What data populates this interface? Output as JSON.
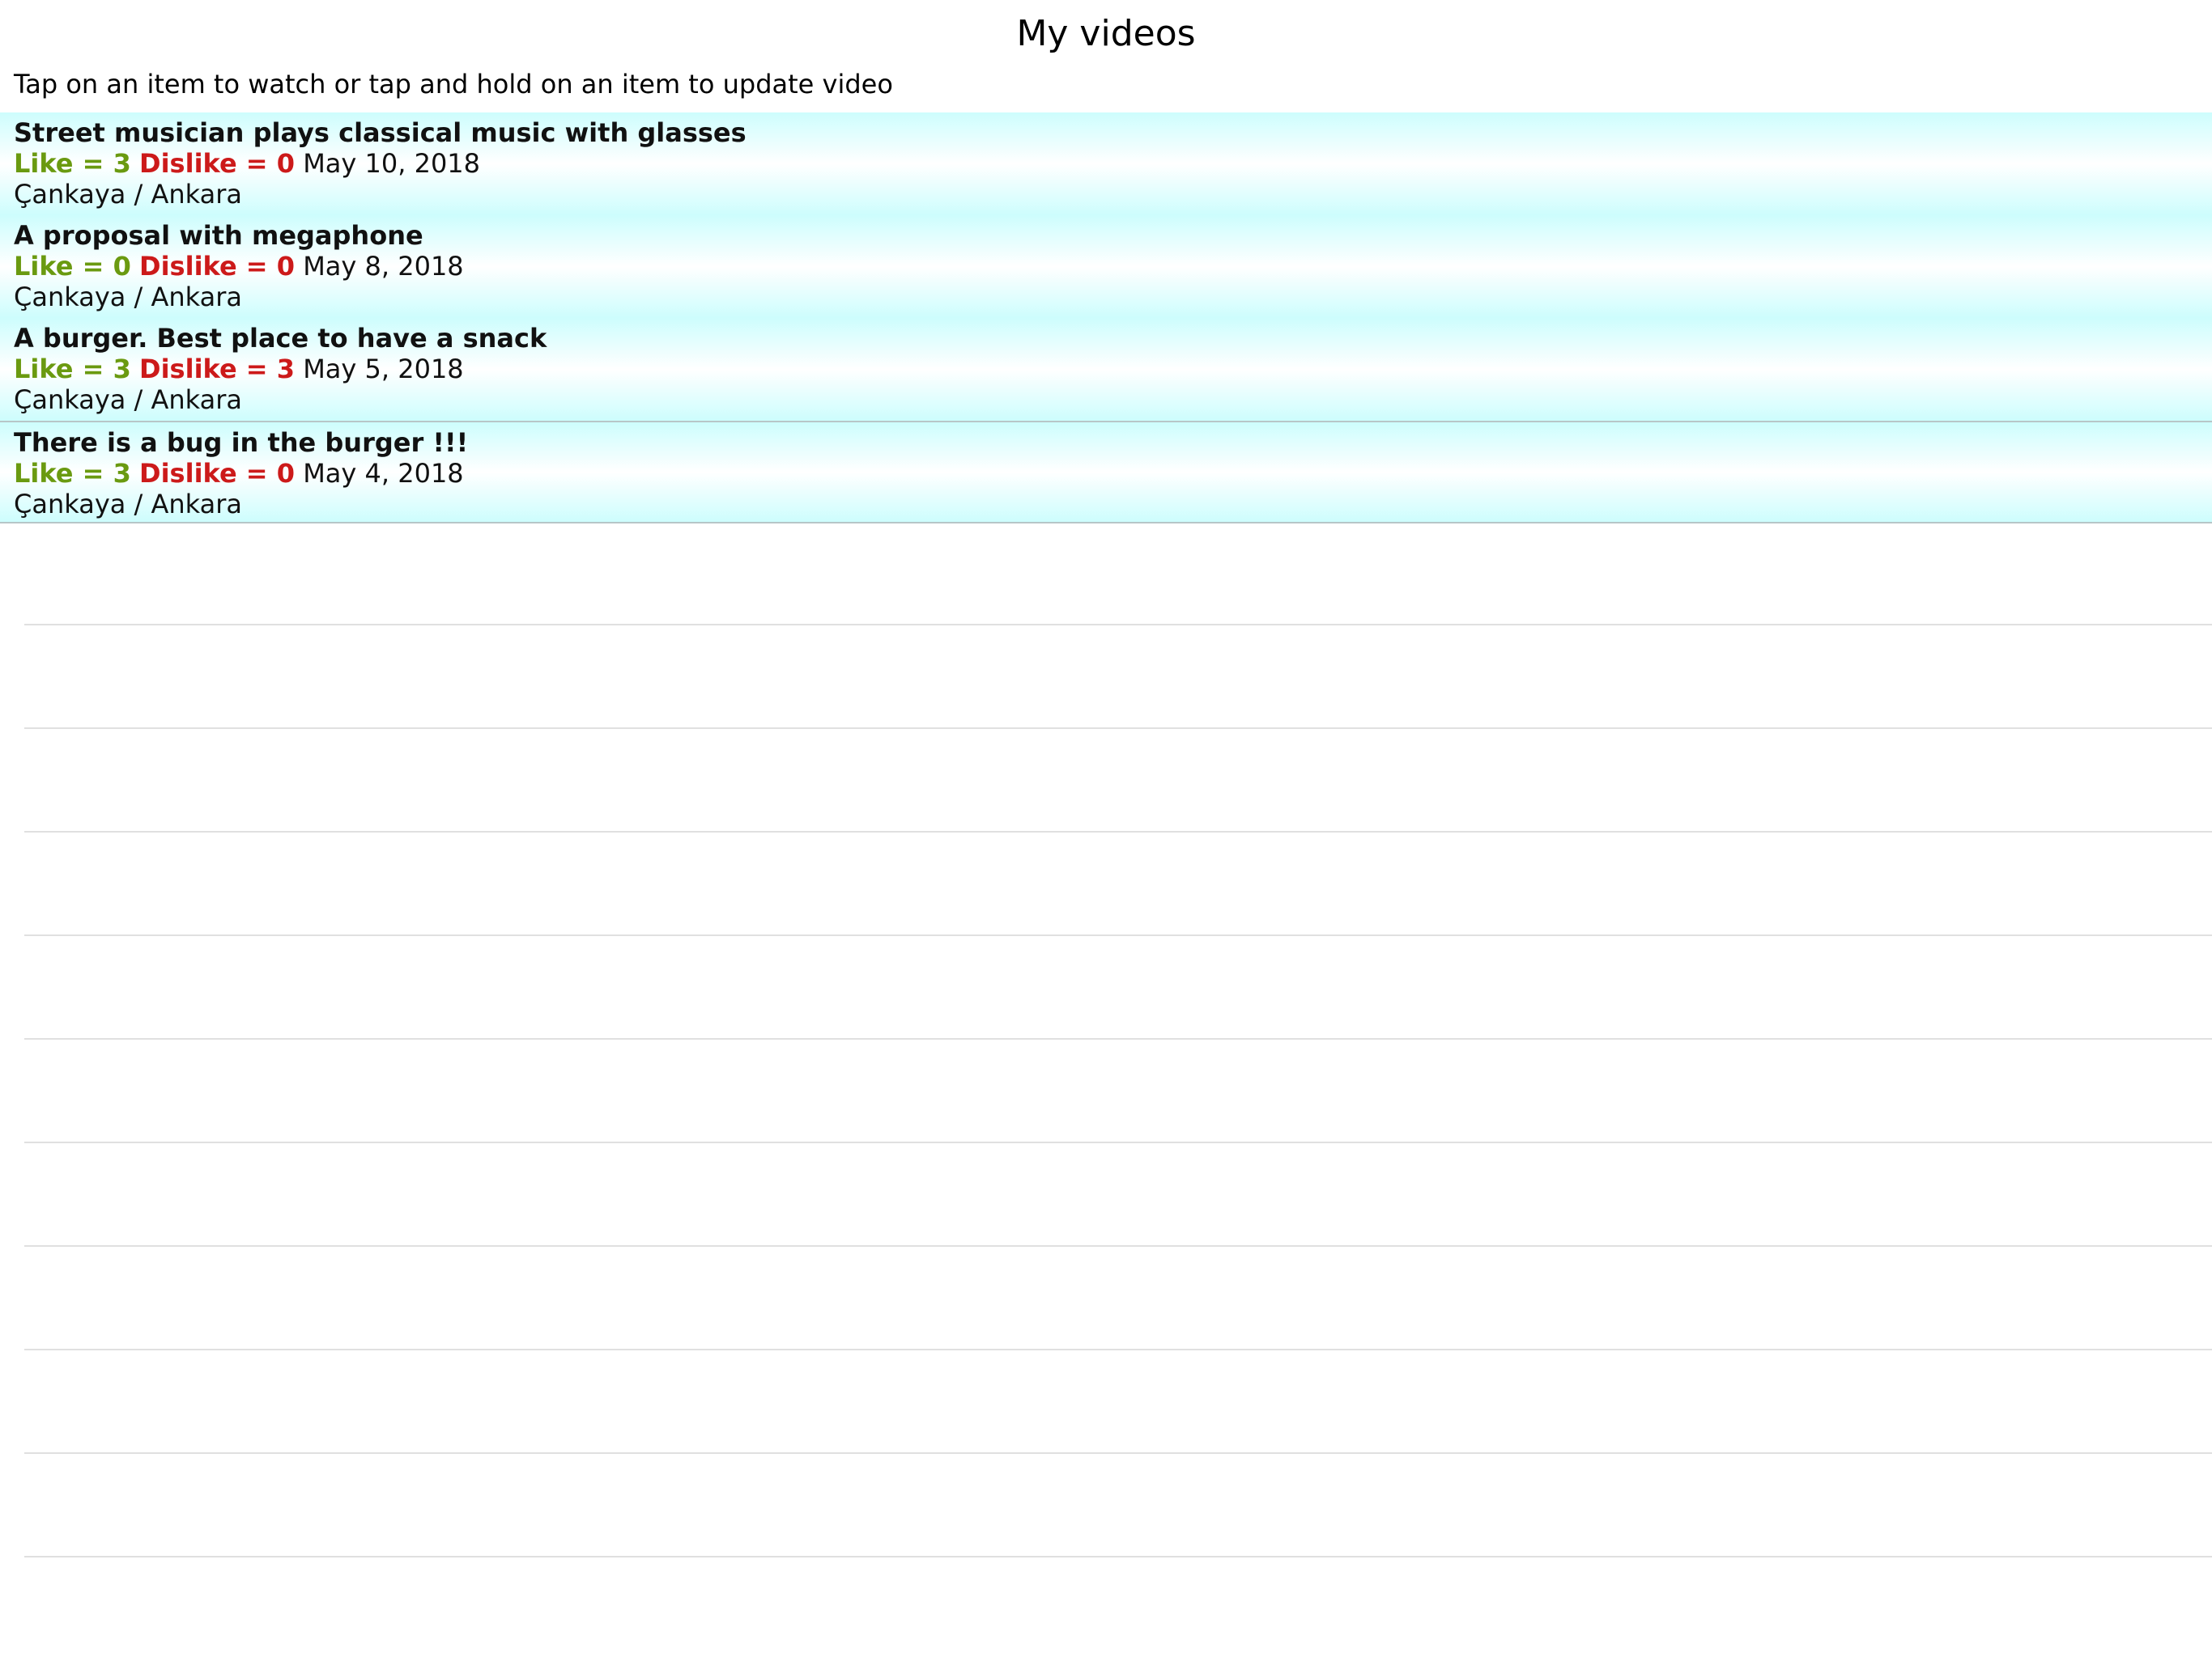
{
  "nav": {
    "title": "My videos"
  },
  "instructions": "Tap on an item to watch or tap and hold on an item to update video",
  "colors": {
    "like": "#6a9a10",
    "dislike": "#cc1a1a",
    "row_gradient_edge": "#cdfdfd",
    "row_gradient_center": "#ffffff"
  },
  "videos": [
    {
      "title": "Street musician plays classical music with glasses",
      "like_text": "Like = 3",
      "dislike_text": "Dislike = 0",
      "date": "May 10, 2018",
      "location": "Çankaya / Ankara"
    },
    {
      "title": "A proposal with megaphone",
      "like_text": "Like = 0",
      "dislike_text": "Dislike = 0",
      "date": "May 8, 2018",
      "location": "Çankaya / Ankara"
    },
    {
      "title": "A burger. Best place to have a snack",
      "like_text": "Like = 3",
      "dislike_text": "Dislike = 3",
      "date": "May 5, 2018",
      "location": "Çankaya / Ankara"
    },
    {
      "title": "There is a bug in the burger !!!",
      "like_text": "Like = 3",
      "dislike_text": "Dislike = 0",
      "date": "May 4, 2018",
      "location": "Çankaya / Ankara"
    }
  ]
}
